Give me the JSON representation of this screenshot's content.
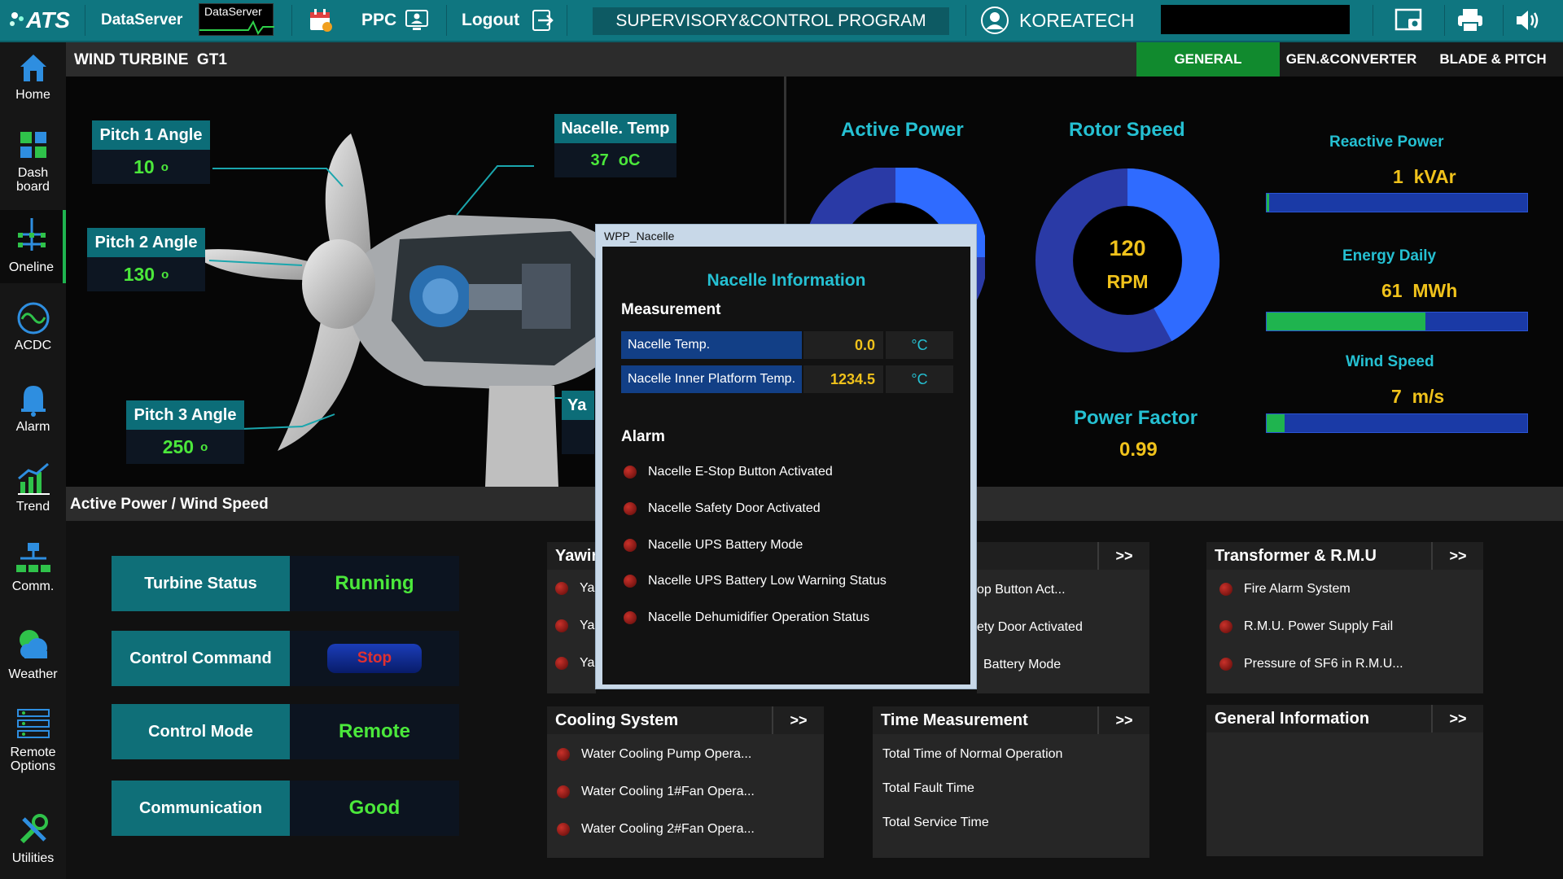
{
  "topbar": {
    "logo": "ATS",
    "dataserver_label": "DataServer",
    "dataserver_mini_label": "DataServer",
    "ppc_label": "PPC",
    "logout_label": "Logout",
    "program_title": "SUPERVISORY&CONTROL PROGRAM",
    "user_name": "KOREATECH"
  },
  "sidebar": {
    "items": [
      {
        "label": "Home",
        "icon": "home-icon"
      },
      {
        "label": "Dash board",
        "icon": "dashboard-icon"
      },
      {
        "label": "Oneline",
        "icon": "oneline-icon"
      },
      {
        "label": "ACDC",
        "icon": "acdc-icon"
      },
      {
        "label": "Alarm",
        "icon": "alarm-icon"
      },
      {
        "label": "Trend",
        "icon": "trend-icon"
      },
      {
        "label": "Comm.",
        "icon": "comm-icon"
      },
      {
        "label": "Weather",
        "icon": "weather-icon"
      },
      {
        "label": "Remote Options",
        "icon": "remote-options-icon"
      },
      {
        "label": "Utilities",
        "icon": "utilities-icon"
      }
    ]
  },
  "page": {
    "title": "WIND TURBINE  GT1",
    "tabs": [
      "GENERAL",
      "GEN.&CONVERTER",
      "BLADE & PITCH"
    ]
  },
  "turbine": {
    "pitch1": {
      "label": "Pitch 1 Angle",
      "value": "10",
      "unit": "o"
    },
    "pitch2": {
      "label": "Pitch 2 Angle",
      "value": "130",
      "unit": "o"
    },
    "pitch3": {
      "label": "Pitch 3 Angle",
      "value": "250",
      "unit": "o"
    },
    "nacelle_temp": {
      "label": "Nacelle. Temp",
      "value": "37",
      "unit": "oC"
    },
    "yaw_partial": "Ya"
  },
  "gauges": {
    "active_power": {
      "title": "Active Power"
    },
    "rotor_speed": {
      "title": "Rotor Speed",
      "value": "120",
      "unit": "RPM",
      "fraction": 0.42
    },
    "power_factor": {
      "title": "Power Factor",
      "value": "0.99"
    },
    "reactive_power": {
      "title": "Reactive Power",
      "value": "1",
      "unit": "kVAr",
      "fraction": 0.01
    },
    "energy_daily": {
      "title": "Energy Daily",
      "value": "61",
      "unit": "MWh",
      "fraction": 0.61
    },
    "wind_speed": {
      "title": "Wind Speed",
      "value": "7",
      "unit": "m/s",
      "fraction": 0.07
    }
  },
  "section_title": "Active Power / Wind Speed",
  "status": [
    {
      "label": "Turbine Status",
      "value": "Running",
      "color": "#4be83b"
    },
    {
      "label": "Control Command",
      "value": "Stop",
      "color": "#e03030"
    },
    {
      "label": "Control Mode",
      "value": "Remote",
      "color": "#4be83b"
    },
    {
      "label": "Communication",
      "value": "Good",
      "color": "#4be83b"
    }
  ],
  "panels": {
    "yawing": {
      "title": "Yawin",
      "rows": [
        "Ya",
        "Ya",
        "Ya"
      ]
    },
    "nacelle_panel": {
      "arrow": ">>",
      "rows": [
        "op Button Act...",
        "ety Door Activated",
        "Battery Mode"
      ]
    },
    "transformer": {
      "title": "Transformer & R.M.U",
      "arrow": ">>",
      "rows": [
        "Fire Alarm System",
        "R.M.U. Power Supply Fail",
        "Pressure of SF6 in R.M.U..."
      ]
    },
    "cooling": {
      "title": "Cooling System",
      "arrow": ">>",
      "rows": [
        "Water Cooling Pump Opera...",
        "Water Cooling 1#Fan Opera...",
        "Water Cooling 2#Fan Opera..."
      ]
    },
    "time": {
      "title": "Time Measurement",
      "arrow": ">>",
      "rows": [
        "Total Time of Normal Operation",
        "Total Fault Time",
        "Total Service Time"
      ]
    },
    "general": {
      "title": "General Information",
      "arrow": ">>"
    }
  },
  "dialog": {
    "window_title": "WPP_Nacelle",
    "heading": "Nacelle Information",
    "measurement_title": "Measurement",
    "measurements": [
      {
        "name": "Nacelle Temp.",
        "value": "0.0",
        "unit": "°C"
      },
      {
        "name": "Nacelle Inner Platform Temp.",
        "value": "1234.5",
        "unit": "°C"
      }
    ],
    "alarm_title": "Alarm",
    "alarms": [
      "Nacelle E-Stop Button Activated",
      "Nacelle Safety Door Activated",
      "Nacelle UPS Battery Mode",
      "Nacelle UPS Battery Low Warning Status",
      "Nacelle Dehumidifier Operation Status"
    ]
  },
  "colors": {
    "teal": "#0f7680",
    "title_cyan": "#25c0d2",
    "value_yellow": "#f0c21b",
    "value_green": "#4be83b",
    "alarm_red": "#b42a22",
    "gauge_blue": "#2f6bff",
    "gauge_dark_blue": "#2a3aa6"
  }
}
